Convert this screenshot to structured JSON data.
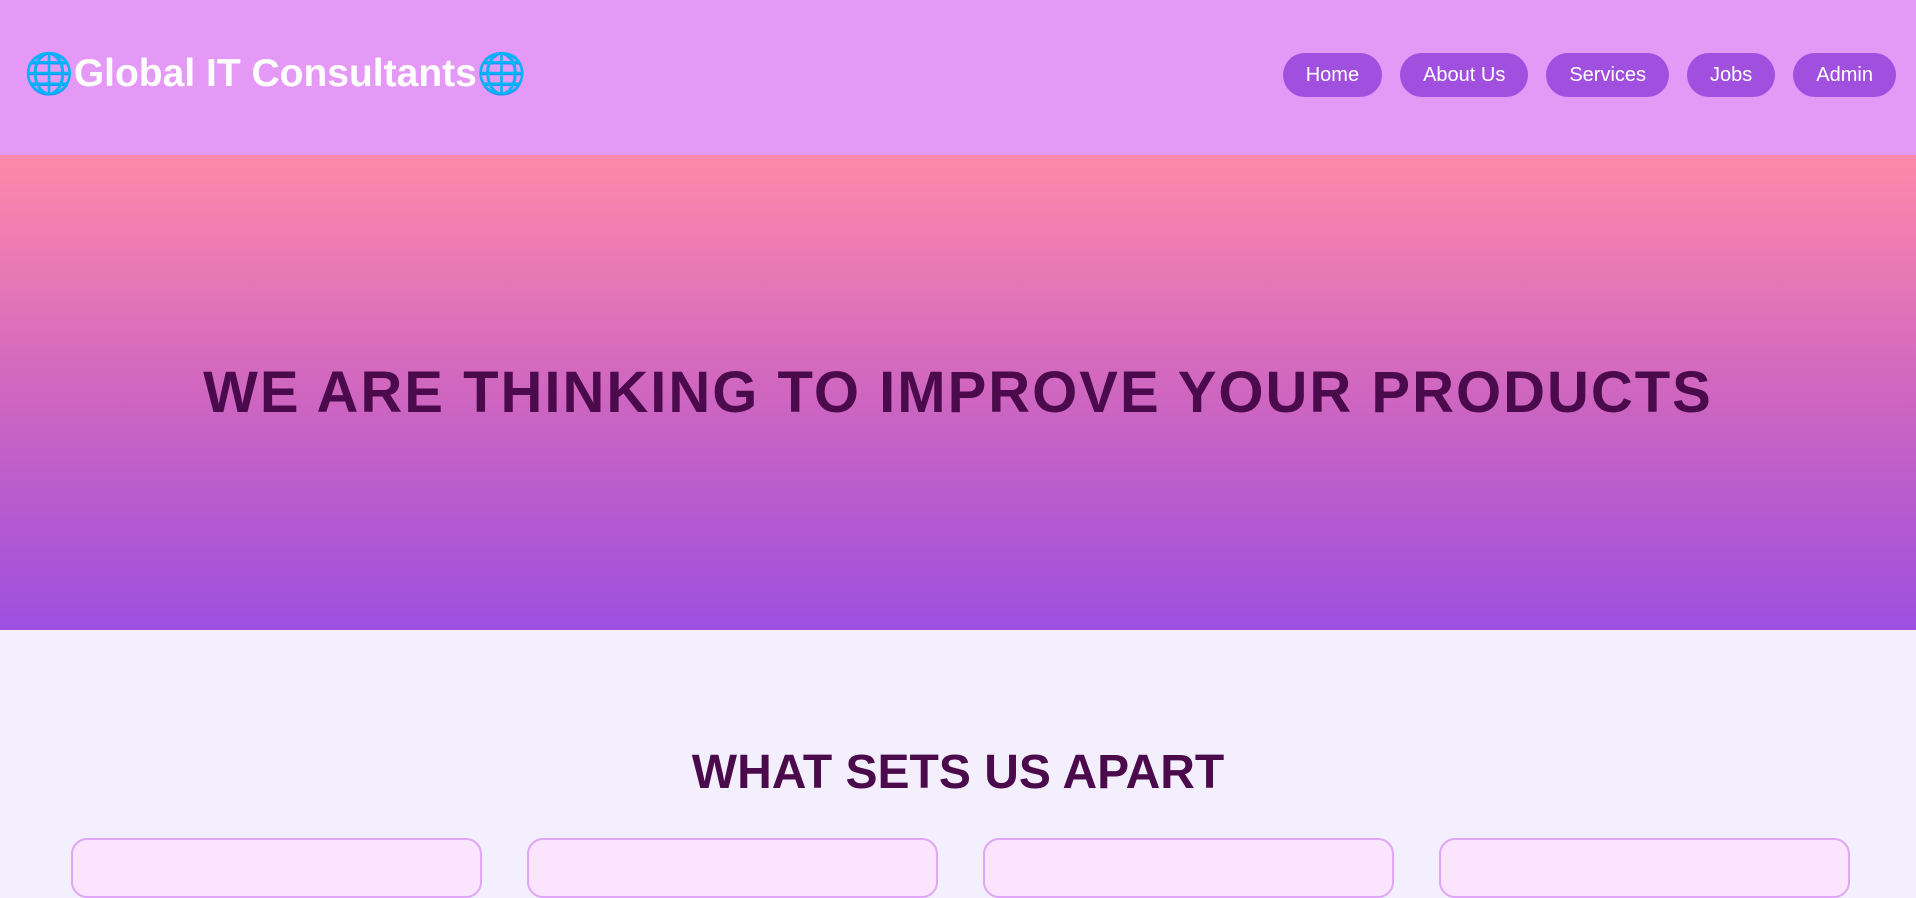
{
  "header": {
    "title": "Global IT Consultants",
    "logo_icon": "globe-icon",
    "nav": [
      {
        "label": "Home"
      },
      {
        "label": "About Us"
      },
      {
        "label": "Services"
      },
      {
        "label": "Jobs"
      },
      {
        "label": "Admin"
      }
    ]
  },
  "hero": {
    "title": "WE ARE THINKING TO IMPROVE YOUR PRODUCTS"
  },
  "features": {
    "title": "WHAT SETS US APART"
  },
  "colors": {
    "header_bg": "#e399f5",
    "nav_button": "#a04fde",
    "hero_top": "#ff89aa",
    "hero_bottom": "#9d4fdf",
    "heading": "#4a0a4c"
  }
}
